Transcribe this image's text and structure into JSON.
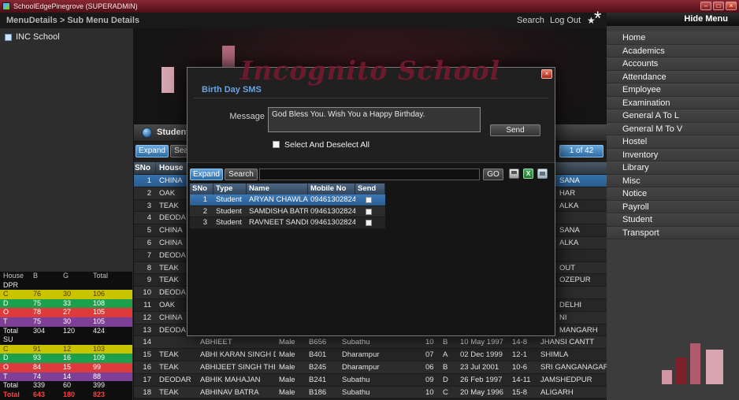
{
  "titlebar": {
    "title": "SchoolEdgePinegrove (SUPERADMIN)"
  },
  "icons": {
    "minimize": "–",
    "maximize": "□",
    "close": "×",
    "star": "★",
    "asterisk": "*",
    "excel": "X"
  },
  "menubar": {
    "breadcrumb": "MenuDetails > Sub Menu Details",
    "search": "Search",
    "logout": "Log Out"
  },
  "sidebar": {
    "header": "Hide Menu",
    "items": [
      "Home",
      "Academics",
      "Accounts",
      "Attendance",
      "Employee",
      "Examination",
      "General A To L",
      "General M To V",
      "Hostel",
      "Inventory",
      "Library",
      "Misc",
      "Notice",
      "Payroll",
      "Student",
      "Transport"
    ]
  },
  "tree": {
    "school": "INC School"
  },
  "watermark": "Incognito School",
  "students": {
    "title": "Students",
    "expand": "Expand",
    "search": "Search",
    "pagination": "1 of 42",
    "header": {
      "sno": "SNo",
      "house": "House"
    },
    "partial_rows": [
      {
        "sno": "1",
        "house": "CHINA",
        "city": "SANA",
        "selected": true
      },
      {
        "sno": "2",
        "house": "OAK",
        "city": "HAR",
        "selected": false
      },
      {
        "sno": "3",
        "house": "TEAK",
        "city": "ALKA",
        "selected": false
      },
      {
        "sno": "4",
        "house": "DEODA",
        "city": "",
        "selected": false
      },
      {
        "sno": "5",
        "house": "CHINA",
        "city": "SANA",
        "selected": false
      },
      {
        "sno": "6",
        "house": "CHINA",
        "city": "ALKA",
        "selected": false
      },
      {
        "sno": "7",
        "house": "DEODA",
        "city": "",
        "selected": false
      },
      {
        "sno": "8",
        "house": "TEAK",
        "city": "OUT",
        "selected": false
      },
      {
        "sno": "9",
        "house": "TEAK",
        "city": "OZEPUR",
        "selected": false
      },
      {
        "sno": "10",
        "house": "DEODA",
        "city": "",
        "selected": false
      },
      {
        "sno": "11",
        "house": "OAK",
        "city": "DELHI",
        "selected": false
      },
      {
        "sno": "12",
        "house": "CHINA",
        "city": "NI",
        "selected": false
      },
      {
        "sno": "13",
        "house": "DEODA",
        "city": "MANGARH",
        "selected": false
      }
    ],
    "full_rows": [
      {
        "sno": "14",
        "house": "",
        "name": "ABHIEET",
        "gender": "Male",
        "room": "B656",
        "campus": "Subathu",
        "cls": "10",
        "sec": "B",
        "dob": "10 May 1997",
        "age": "14-8",
        "city": "JHANSI CANTT"
      },
      {
        "sno": "15",
        "house": "TEAK",
        "name": "ABHI KARAN SINGH DOGRA",
        "gender": "Male",
        "room": "B401",
        "campus": "Dharampur",
        "cls": "07",
        "sec": "A",
        "dob": "02 Dec 1999",
        "age": "12-1",
        "city": "SHIMLA"
      },
      {
        "sno": "16",
        "house": "TEAK",
        "name": "ABHIJEET SINGH THIND",
        "gender": "Male",
        "room": "B245",
        "campus": "Dharampur",
        "cls": "06",
        "sec": "B",
        "dob": "23 Jul 2001",
        "age": "10-6",
        "city": "SRI GANGANAGAR"
      },
      {
        "sno": "17",
        "house": "DEODAR",
        "name": "ABHIK MAHAJAN",
        "gender": "Male",
        "room": "B241",
        "campus": "Subathu",
        "cls": "09",
        "sec": "D",
        "dob": "26 Feb 1997",
        "age": "14-11",
        "city": "JAMSHEDPUR"
      },
      {
        "sno": "18",
        "house": "TEAK",
        "name": "ABHINAV BATRA",
        "gender": "Male",
        "room": "B186",
        "campus": "Subathu",
        "cls": "10",
        "sec": "C",
        "dob": "20 May 1996",
        "age": "15-8",
        "city": "ALIGARH"
      }
    ]
  },
  "stats": {
    "columns": [
      "House",
      "B",
      "G",
      "Total"
    ],
    "house_colors": {
      "yellow": "#c9c400",
      "green": "#1ca04c",
      "red": "#dd3b3b",
      "purple": "#7d3f98"
    },
    "rows": [
      {
        "type": "section",
        "label": "DPR",
        "b": "",
        "g": "",
        "total": ""
      },
      {
        "type": "house",
        "label": "C",
        "b": "76",
        "g": "30",
        "total": "106",
        "color": "yellow"
      },
      {
        "type": "house",
        "label": "D",
        "b": "75",
        "g": "33",
        "total": "108",
        "color": "green"
      },
      {
        "type": "house",
        "label": "O",
        "b": "78",
        "g": "27",
        "total": "105",
        "color": "red"
      },
      {
        "type": "house",
        "label": "T",
        "b": "75",
        "g": "30",
        "total": "105",
        "color": "purple"
      },
      {
        "type": "total",
        "label": "Total",
        "b": "304",
        "g": "120",
        "total": "424"
      },
      {
        "type": "section",
        "label": "SU",
        "b": "",
        "g": "",
        "total": ""
      },
      {
        "type": "house",
        "label": "C",
        "b": "91",
        "g": "12",
        "total": "103",
        "color": "yellow"
      },
      {
        "type": "house",
        "label": "D",
        "b": "93",
        "g": "16",
        "total": "109",
        "color": "green"
      },
      {
        "type": "house",
        "label": "O",
        "b": "84",
        "g": "15",
        "total": "99",
        "color": "red"
      },
      {
        "type": "house",
        "label": "T",
        "b": "74",
        "g": "14",
        "total": "88",
        "color": "purple"
      },
      {
        "type": "total",
        "label": "Total",
        "b": "339",
        "g": "60",
        "total": "399"
      },
      {
        "type": "grand",
        "label": "Total",
        "b": "643",
        "g": "180",
        "total": "823"
      }
    ]
  },
  "modal": {
    "title": "Birth Day SMS",
    "message_label": "Message",
    "message_text": "God Bless You. Wish You a Happy Birthday.",
    "send": "Send",
    "select_all": "Select And Deselect All",
    "expand": "Expand",
    "search": "Search",
    "go": "GO",
    "columns": [
      "SNo",
      "Type",
      "Name",
      "Mobile No",
      "Send"
    ],
    "rows": [
      {
        "sno": "1",
        "type": "Student",
        "name": "ARYAN CHAWLA",
        "mobile": "09461302824",
        "selected": true
      },
      {
        "sno": "2",
        "type": "Student",
        "name": "SAMDISHA BATRA",
        "mobile": "09461302824",
        "selected": false
      },
      {
        "sno": "3",
        "type": "Student",
        "name": "RAVNEET SANDHU",
        "mobile": "09461302824",
        "selected": false
      }
    ]
  }
}
